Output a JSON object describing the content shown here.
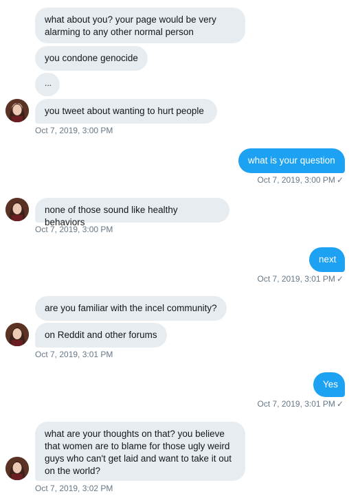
{
  "conversation": {
    "messages": [
      {
        "text": "what about you? your page would be very alarming to any other normal person",
        "direction": "in"
      },
      {
        "text": "you condone genocide",
        "direction": "in"
      },
      {
        "text": "...",
        "direction": "in"
      },
      {
        "text": "you tweet about wanting to hurt people",
        "direction": "in"
      },
      {
        "text": "what is your question",
        "direction": "out"
      },
      {
        "text": "none of those sound like healthy behaviors",
        "direction": "in"
      },
      {
        "text": "next",
        "direction": "out"
      },
      {
        "text": "are you familiar with the incel community?",
        "direction": "in"
      },
      {
        "text": "on Reddit and other forums",
        "direction": "in"
      },
      {
        "text": "Yes",
        "direction": "out"
      },
      {
        "text": "what are your thoughts on that? you believe that women are to blame for those ugly weird guys who can't get laid and want to take it out on the world?",
        "direction": "in"
      }
    ],
    "timestamps": [
      "Oct 7, 2019, 3:00 PM",
      "Oct 7, 2019, 3:00 PM",
      "Oct 7, 2019, 3:00 PM",
      "Oct 7, 2019, 3:01 PM",
      "Oct 7, 2019, 3:01 PM",
      "Oct 7, 2019, 3:01 PM",
      "Oct 7, 2019, 3:02 PM"
    ],
    "read_check": "✓"
  },
  "colors": {
    "incoming_bubble": "#e6ecf0",
    "outgoing_bubble": "#1da1f2",
    "timestamp": "#657786"
  },
  "icons": [
    "avatar",
    "check-icon"
  ]
}
